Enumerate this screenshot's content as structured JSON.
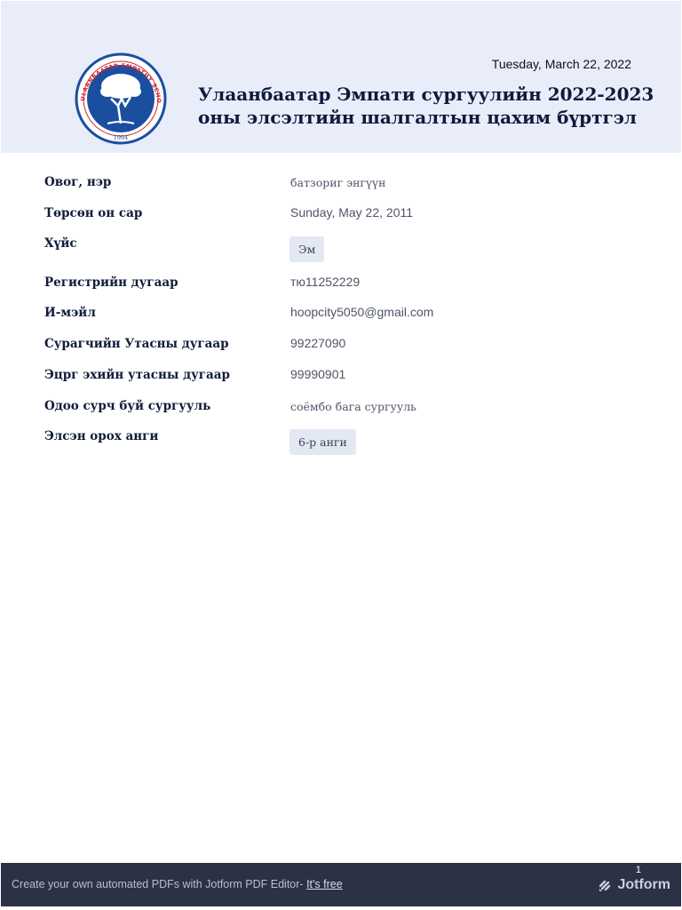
{
  "header": {
    "date": "Tuesday, March 22, 2022",
    "title_line1": "Улаанбаатар Эмпати сургуулийн 2022-2023",
    "title_line2": "оны элсэлтийн шалгалтын цахим бүртгэл",
    "logo": {
      "icon": "tree-icon",
      "ring_text": "ULAANBAATAR EMPATHY SCHOOL",
      "year": "1994",
      "colors": {
        "ring": "#1a4fa0",
        "accent": "#d2232a"
      }
    }
  },
  "fields": [
    {
      "label": "Овог, нэр",
      "value": "батзориг энгүүн"
    },
    {
      "label": "Төрсөн он сар",
      "value": "Sunday, May 22, 2011"
    },
    {
      "label": "Хүйс",
      "value": "Эм"
    },
    {
      "label": "Регистрийн дугаар",
      "value": "тю11252229"
    },
    {
      "label": "И-мэйл",
      "value": "hoopcity5050@gmail.com"
    },
    {
      "label": "Сурагчийн Утасны дугаар",
      "value": "99227090"
    },
    {
      "label": "Эцрг эхийн утасны дугаар",
      "value": "99990901"
    },
    {
      "label": "Одоо сурч буй сургууль",
      "value": "соёмбо бага сургууль"
    },
    {
      "label": "Элсэн орох анги",
      "value": "6-р анги"
    }
  ],
  "footer": {
    "text": "Create your own automated PDFs with Jotform PDF Editor-",
    "link": "It's free",
    "page_number": "1",
    "brand": "Jotform",
    "brand_icon": "jotform-logo-icon"
  }
}
